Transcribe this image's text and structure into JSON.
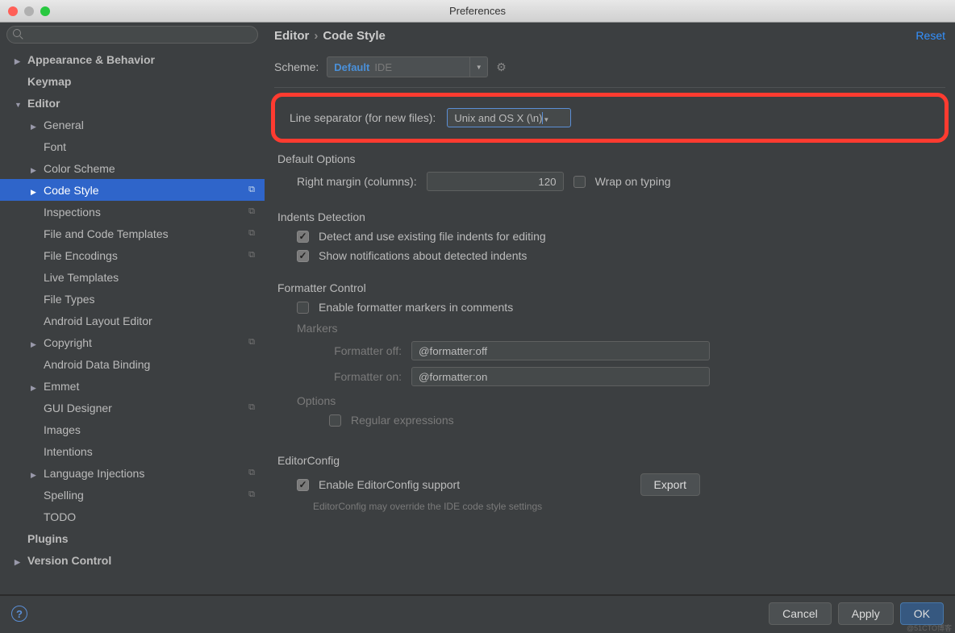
{
  "window": {
    "title": "Preferences"
  },
  "search": {
    "placeholder": ""
  },
  "sidebar": {
    "items": [
      {
        "label": "Appearance & Behavior",
        "bold": true,
        "arrow": "right",
        "indent": 0
      },
      {
        "label": "Keymap",
        "bold": true,
        "arrow": "",
        "indent": 0
      },
      {
        "label": "Editor",
        "bold": true,
        "arrow": "down",
        "indent": 0
      },
      {
        "label": "General",
        "bold": false,
        "arrow": "right",
        "indent": 1
      },
      {
        "label": "Font",
        "bold": false,
        "arrow": "",
        "indent": 1
      },
      {
        "label": "Color Scheme",
        "bold": false,
        "arrow": "right",
        "indent": 1
      },
      {
        "label": "Code Style",
        "bold": false,
        "arrow": "right",
        "indent": 1,
        "selected": true,
        "copy": true
      },
      {
        "label": "Inspections",
        "bold": false,
        "arrow": "",
        "indent": 1,
        "copy": true
      },
      {
        "label": "File and Code Templates",
        "bold": false,
        "arrow": "",
        "indent": 1,
        "copy": true
      },
      {
        "label": "File Encodings",
        "bold": false,
        "arrow": "",
        "indent": 1,
        "copy": true
      },
      {
        "label": "Live Templates",
        "bold": false,
        "arrow": "",
        "indent": 1
      },
      {
        "label": "File Types",
        "bold": false,
        "arrow": "",
        "indent": 1
      },
      {
        "label": "Android Layout Editor",
        "bold": false,
        "arrow": "",
        "indent": 1
      },
      {
        "label": "Copyright",
        "bold": false,
        "arrow": "right",
        "indent": 1,
        "copy": true
      },
      {
        "label": "Android Data Binding",
        "bold": false,
        "arrow": "",
        "indent": 1
      },
      {
        "label": "Emmet",
        "bold": false,
        "arrow": "right",
        "indent": 1
      },
      {
        "label": "GUI Designer",
        "bold": false,
        "arrow": "",
        "indent": 1,
        "copy": true
      },
      {
        "label": "Images",
        "bold": false,
        "arrow": "",
        "indent": 1
      },
      {
        "label": "Intentions",
        "bold": false,
        "arrow": "",
        "indent": 1
      },
      {
        "label": "Language Injections",
        "bold": false,
        "arrow": "right",
        "indent": 1,
        "copy": true
      },
      {
        "label": "Spelling",
        "bold": false,
        "arrow": "",
        "indent": 1,
        "copy": true
      },
      {
        "label": "TODO",
        "bold": false,
        "arrow": "",
        "indent": 1
      },
      {
        "label": "Plugins",
        "bold": true,
        "arrow": "",
        "indent": 0
      },
      {
        "label": "Version Control",
        "bold": true,
        "arrow": "right",
        "indent": 0
      }
    ]
  },
  "breadcrumb": {
    "root": "Editor",
    "sep": "›",
    "leaf": "Code Style"
  },
  "reset": "Reset",
  "scheme": {
    "label": "Scheme:",
    "value": "Default",
    "tag": "IDE"
  },
  "line_sep": {
    "label": "Line separator (for new files):",
    "value": "Unix and OS X (\\n)"
  },
  "default_options": {
    "title": "Default Options",
    "right_margin_label": "Right margin (columns):",
    "right_margin_value": "120",
    "wrap_on_typing": "Wrap on typing"
  },
  "indents": {
    "title": "Indents Detection",
    "detect": "Detect and use existing file indents for editing",
    "notify": "Show notifications about detected indents"
  },
  "formatter": {
    "title": "Formatter Control",
    "enable": "Enable formatter markers in comments",
    "markers": "Markers",
    "off_label": "Formatter off:",
    "off_value": "@formatter:off",
    "on_label": "Formatter on:",
    "on_value": "@formatter:on",
    "options": "Options",
    "regex": "Regular expressions"
  },
  "editorconfig": {
    "title": "EditorConfig",
    "enable": "Enable EditorConfig support",
    "export": "Export",
    "hint": "EditorConfig may override the IDE code style settings"
  },
  "footer": {
    "cancel": "Cancel",
    "apply": "Apply",
    "ok": "OK",
    "help": "?"
  },
  "colors": {
    "accent": "#2f65ca",
    "highlight": "#ff3b30"
  }
}
